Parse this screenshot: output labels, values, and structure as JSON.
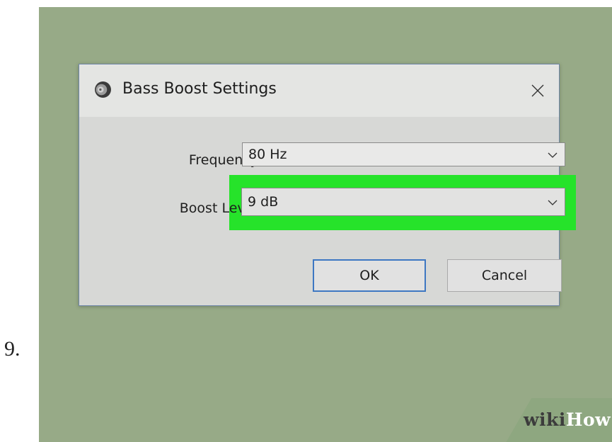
{
  "step": {
    "number": "9."
  },
  "dialog": {
    "title": "Bass Boost Settings",
    "icon": "speaker-icon",
    "close_icon": "close-icon",
    "fields": {
      "frequency": {
        "label": "Frequency:",
        "value": "80 Hz"
      },
      "boost_level": {
        "label": "Boost Level:",
        "value": "9 dB"
      }
    },
    "buttons": {
      "ok": "OK",
      "cancel": "Cancel"
    }
  },
  "watermark": {
    "wiki": "wiki",
    "how": "How"
  },
  "colors": {
    "background": "#97aa87",
    "highlight": "#26e32a",
    "ok_border": "#3e77c2",
    "dialog_bg": "#d7d8d6"
  }
}
